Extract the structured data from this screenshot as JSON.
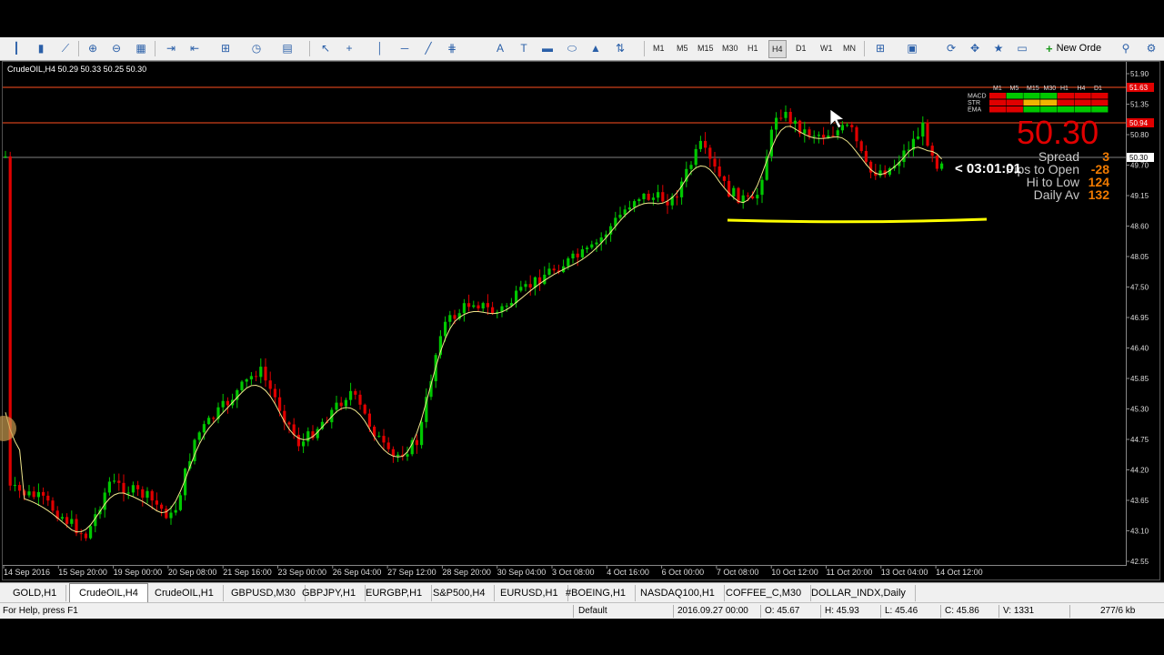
{
  "toolbar": {
    "timeframes": [
      "M1",
      "M5",
      "M15",
      "M30",
      "H1",
      "H4",
      "D1",
      "W1",
      "MN"
    ],
    "active_timeframe": "H4",
    "new_order_label": "New Orde"
  },
  "chart": {
    "title": "CrudeOIL,H4  50.29 50.33 50.25 50.30",
    "price_labels": [
      "51.90",
      "51.35",
      "50.80",
      "49.70",
      "49.15",
      "48.60",
      "48.05",
      "47.50",
      "46.95",
      "46.40",
      "45.85",
      "45.30",
      "44.75",
      "44.20",
      "43.65",
      "43.10",
      "42.55"
    ],
    "marker_prices": {
      "upper": "51.63",
      "lower": "50.94",
      "bid": "50.30"
    },
    "time_labels": [
      "14 Sep 2016",
      "15 Sep 20:00",
      "19 Sep 00:00",
      "20 Sep 08:00",
      "21 Sep 16:00",
      "23 Sep 00:00",
      "26 Sep 04:00",
      "27 Sep 12:00",
      "28 Sep 20:00",
      "30 Sep 04:00",
      "3 Oct 08:00",
      "4 Oct 16:00",
      "6 Oct 00:00",
      "7 Oct 08:00",
      "10 Oct 12:00",
      "11 Oct 20:00",
      "13 Oct 04:00",
      "14 Oct 12:00"
    ],
    "colors": {
      "bull": "#00c800",
      "bear": "#e00000",
      "ma": "#f0e68c",
      "support_line": "#ffff00",
      "level_line": "#ff5020"
    }
  },
  "indicator_panel": {
    "timeframes": [
      "M1",
      "M5",
      "M15",
      "M30",
      "H1",
      "H4",
      "D1"
    ],
    "rows": [
      "MACD",
      "STR",
      "EMA"
    ]
  },
  "info": {
    "price": "50.30",
    "spread_label": "Spread",
    "spread_value": "3",
    "to_open_label": "Pips to Open",
    "to_open_value": "-28",
    "hi_low_label": "Hi to Low",
    "hi_low_value": "124",
    "daily_av_label": "Daily Av",
    "daily_av_value": "132",
    "countdown": "< 03:01:01"
  },
  "tabs": [
    "GOLD,H1",
    "CrudeOIL,H4",
    "CrudeOIL,H1",
    "GBPUSD,M30",
    "GBPJPY,H1",
    "EURGBP,H1",
    "S&P500,H4",
    "EURUSD,H1",
    "#BOEING,H1",
    "NASDAQ100,H1",
    "COFFEE_C,M30",
    "DOLLAR_INDX,Daily"
  ],
  "active_tab": "CrudeOIL,H4",
  "status": {
    "help": "For Help, press F1",
    "profile": "Default",
    "datetime": "2016.09.27 00:00",
    "open": "O: 45.67",
    "high": "H: 45.93",
    "low": "L: 45.46",
    "close": "C: 45.86",
    "volume": "V: 1331",
    "traffic": "277/6 kb"
  }
}
